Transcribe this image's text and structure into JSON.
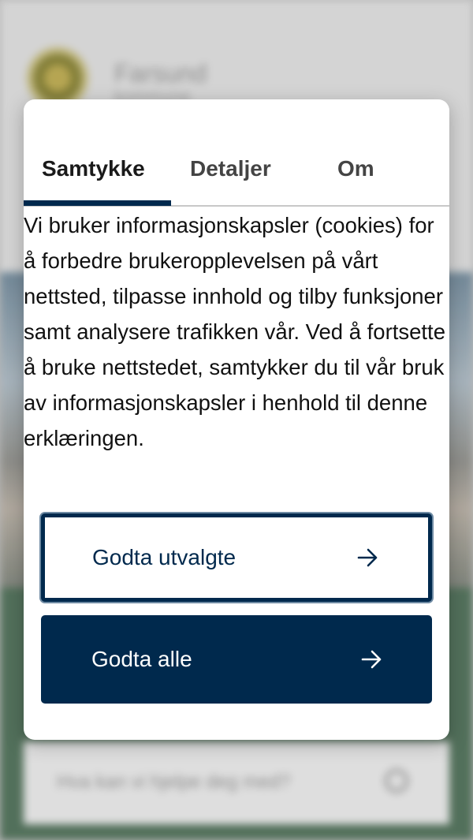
{
  "background": {
    "logo_text_line1": "Farsund",
    "logo_text_line2": "kommune",
    "search_placeholder": "Hva kan vi hjelpe deg med?"
  },
  "dialog": {
    "tabs": [
      {
        "label": "Samtykke",
        "active": true
      },
      {
        "label": "Detaljer",
        "active": false
      },
      {
        "label": "Om",
        "active": false
      }
    ],
    "body_text": "Vi bruker informasjonskapsler (cookies) for å forbedre brukeropplevelsen på vårt nettsted, tilpasse innhold og tilby funksjoner samt analysere trafikken vår. Ved å fortsette å bruke nettstedet, samtykker du til vår bruk av informasjonskapsler i henhold til denne erklæringen.",
    "accept_selected_label": "Godta utvalgte",
    "accept_all_label": "Godta alle"
  },
  "colors": {
    "brand_navy": "#00294d",
    "tab_active_text": "#1a1a1a",
    "tab_inactive_text": "#444444"
  },
  "icons": {
    "button_arrow": "arrow-right-icon",
    "search": "search-icon"
  }
}
